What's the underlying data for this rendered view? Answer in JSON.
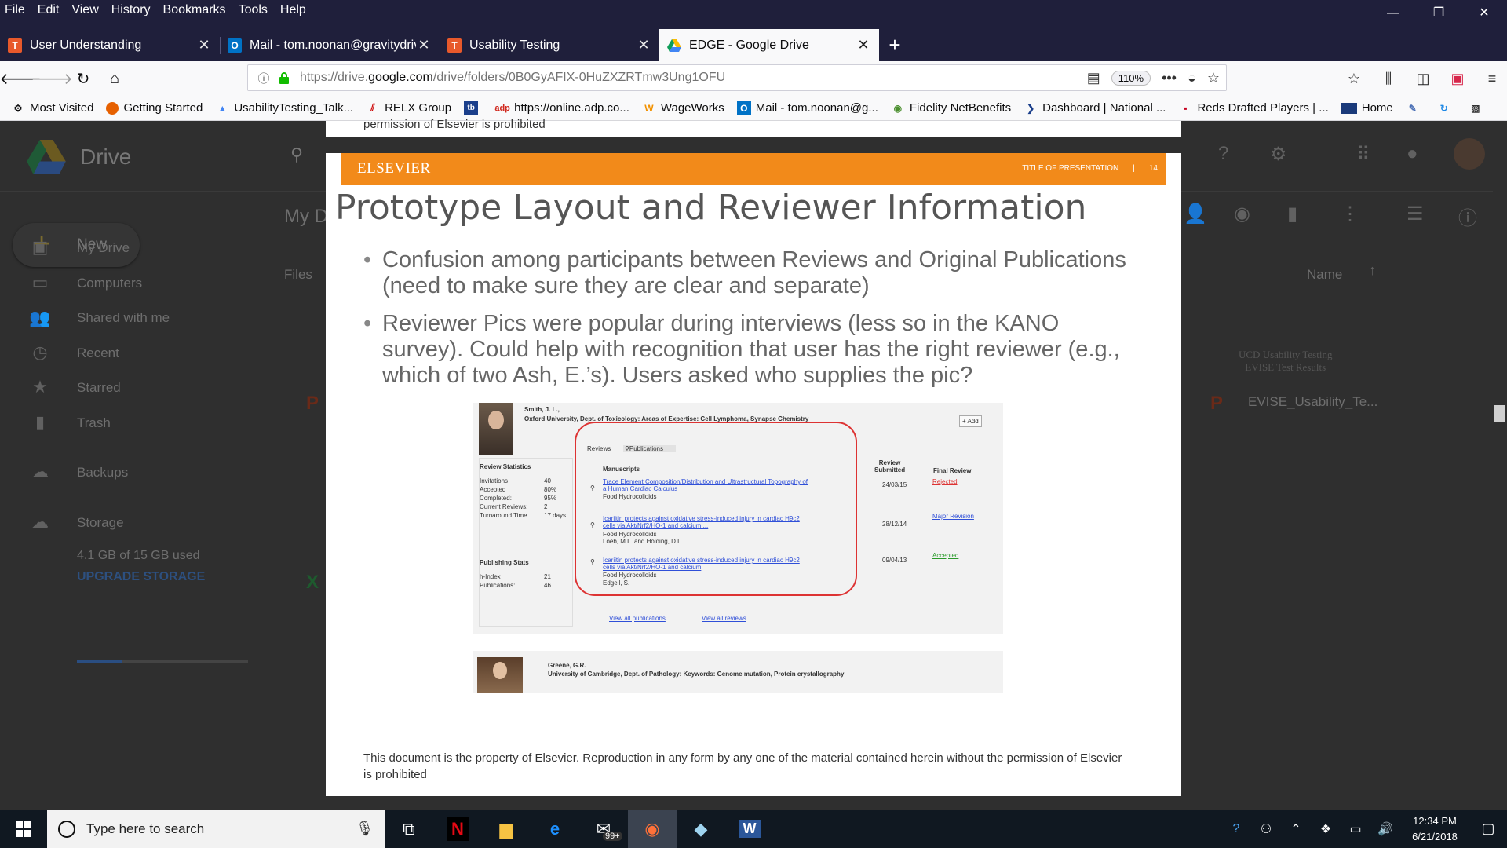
{
  "menu": [
    "File",
    "Edit",
    "View",
    "History",
    "Bookmarks",
    "Tools",
    "Help"
  ],
  "window_controls": {
    "minimize": "—",
    "restore": "❐",
    "close": "✕"
  },
  "tabs": [
    {
      "title": "User Understanding",
      "favicon": "T",
      "favicon_color": "#e8592b"
    },
    {
      "title": "Mail - tom.noonan@gravitydriv",
      "favicon": "O",
      "favicon_color": "#0072c6"
    },
    {
      "title": "Usability Testing",
      "favicon": "T",
      "favicon_color": "#e8592b"
    },
    {
      "title": "EDGE - Google Drive",
      "favicon": "drive",
      "favicon_color": "#4285f4"
    }
  ],
  "url": {
    "prefix": "https://drive.",
    "host": "google.com",
    "path": "/drive/folders/0B0GyAFIX-0HuZXZRTmw3Ung1OFU",
    "zoom": "110%"
  },
  "bookmarks": [
    {
      "label": "Most Visited",
      "icon": "gear-icon"
    },
    {
      "label": "Getting Started",
      "icon": "firefox-icon"
    },
    {
      "label": "UsabilityTesting_Talk...",
      "icon": "drive-icon"
    },
    {
      "label": "RELX Group",
      "icon": "relx-icon"
    },
    {
      "label": "",
      "icon": "app-icon"
    },
    {
      "label": "https://online.adp.co...",
      "icon": "adp-icon"
    },
    {
      "label": "WageWorks",
      "icon": "wageworks-icon"
    },
    {
      "label": "Mail - tom.noonan@g...",
      "icon": "outlook-icon"
    },
    {
      "label": "Fidelity NetBenefits",
      "icon": "fidelity-icon"
    },
    {
      "label": "Dashboard | National ...",
      "icon": "dashboard-icon"
    },
    {
      "label": "Reds Drafted Players | ...",
      "icon": "mlb-icon"
    },
    {
      "label": "Home",
      "icon": "home-icon"
    }
  ],
  "drive": {
    "title": "Drive",
    "new_label": "New",
    "breadcrumb": "My D",
    "files_header": "Files",
    "name_header": "Name",
    "sidebar": [
      "My Drive",
      "Computers",
      "Shared with me",
      "Recent",
      "Starred",
      "Trash",
      "Backups",
      "Storage"
    ],
    "storage_used": "4.1 GB of 15 GB used",
    "upgrade": "UPGRADE STORAGE",
    "file_card_title": "UCD Usability Testing\nEVISE Test Results",
    "file_name": "EVISE_Usability_Te..."
  },
  "slide": {
    "top_fragment": "permission of Elsevier is prohibited",
    "brand": "ELSEVIER",
    "banner_title": "TITLE OF PRESENTATION",
    "banner_sep": "|",
    "page": "14",
    "title": "Prototype Layout and Reviewer Information",
    "bullets": [
      "Confusion among participants between Reviews and Original Publications (need to make sure they are clear and separate)",
      "Reviewer Pics were popular during interviews (less so in the KANO survey). Could help with recognition that user has the right reviewer (e.g., which of two Ash, E.’s). Users asked who supplies the pic?"
    ],
    "footer": "This document is the property of Elsevier. Reproduction in any form by any one of the material contained herein without the permission of Elsevier is prohibited"
  },
  "mockup": {
    "name": "Smith, J. L.,",
    "affiliation": "Oxford University, Dept. of Toxicology:    Areas of Expertise: Cell Lymphoma, Synapse Chemistry",
    "add": "+ Add",
    "review_stats_title": "Review Statistics",
    "stats": [
      {
        "label": "Invitations",
        "value": "40"
      },
      {
        "label": "Accepted",
        "value": "80%"
      },
      {
        "label": "Completed:",
        "value": "95%"
      },
      {
        "label": "Current Reviews:",
        "value": "2"
      },
      {
        "label": "Turnaround Time",
        "value": "17 days"
      }
    ],
    "pub_stats_title": "Publishing Stats",
    "pub_stats": [
      {
        "label": "h-Index",
        "value": "21"
      },
      {
        "label": "Publications:",
        "value": "46"
      }
    ],
    "tab_reviews": "Reviews",
    "tab_publications": "Publications",
    "col_manuscripts": "Manuscripts",
    "col_submitted": "Review\nSubmitted",
    "col_final": "Final Review",
    "rows": [
      {
        "title1": "Trace Element Composition/Distribution and Ultrastructural Topography of",
        "title2": "a Human Cardiac Calculus",
        "journal": "Food Hydrocolloids",
        "authors": "",
        "date": "24/03/15",
        "status": "Rejected",
        "status_color": "red"
      },
      {
        "title1": "Icariitin protects against oxidative stress-induced injury in cardiac H9c2",
        "title2": "cells via Akt/Nrf2/HO-1 and calcium ...",
        "journal": "Food Hydrocolloids",
        "authors": "Loeb, M.L. and Holding, D.L.",
        "date": "28/12/14",
        "status": "Major Revision",
        "status_color": "blue"
      },
      {
        "title1": "Icariitin protects against oxidative stress-induced injury in cardiac H9c2",
        "title2": "cells via Akt/Nrf2/HO-1 and calcium",
        "journal": "Food Hydrocolloids",
        "authors": "Edgell, S.",
        "date": "09/04/13",
        "status": "Accepted",
        "status_color": "green"
      }
    ],
    "view_pubs": "View all publications",
    "view_reviews": "View all reviews",
    "name2": "Greene, G.R.",
    "affiliation2": "University of Cambridge, Dept. of Pathology: Keywords: Genome mutation, Protein crystallography"
  },
  "taskbar": {
    "search_placeholder": "Type here to search",
    "badge": "99+",
    "time": "12:34 PM",
    "date": "6/21/2018"
  }
}
